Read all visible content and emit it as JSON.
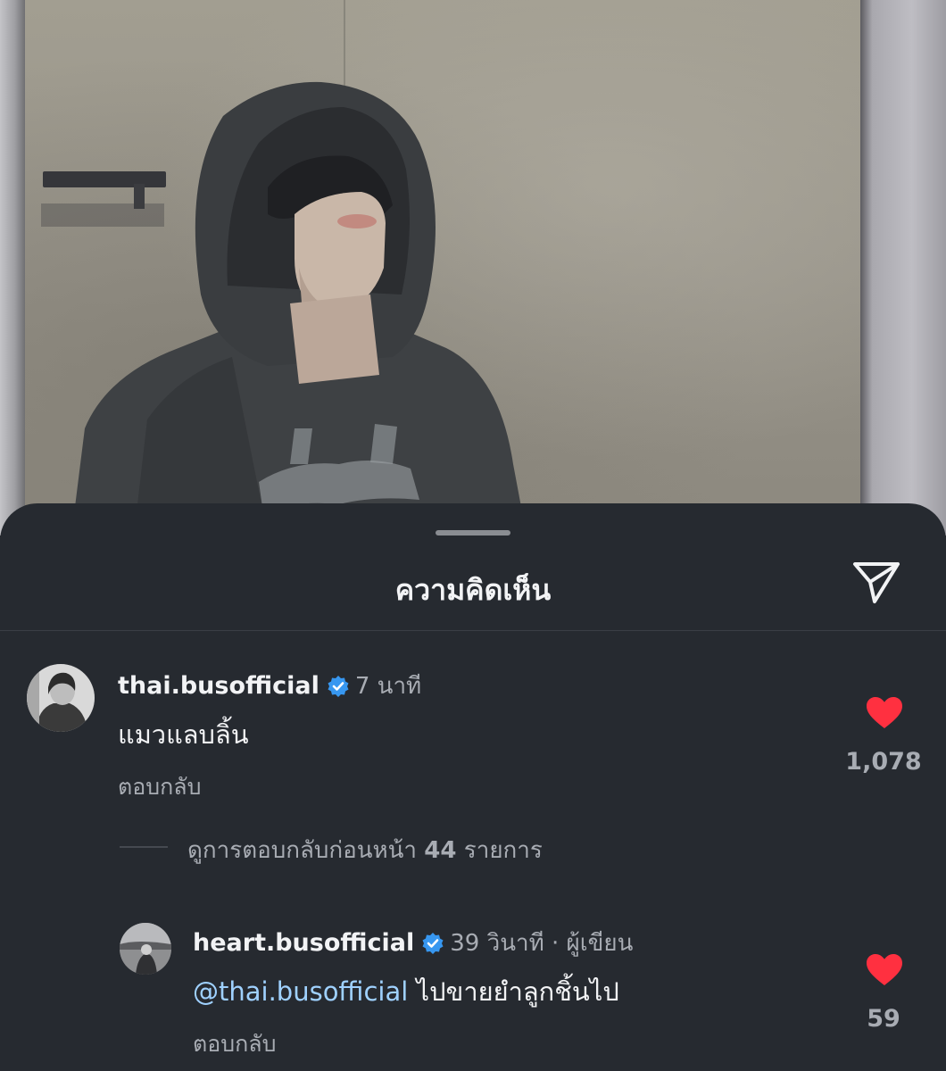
{
  "sheet": {
    "title": "ความคิดเห็น",
    "share_icon": "send-icon"
  },
  "comments": [
    {
      "username": "thai.busofficial",
      "verified": true,
      "time": "7 นาที",
      "text": "แมวแลบลิ้น",
      "reply_label": "ตอบกลับ",
      "likes": "1,078"
    }
  ],
  "view_replies": {
    "prefix": "ดูการตอบกลับก่อนหน้า",
    "count": "44",
    "suffix": "รายการ"
  },
  "replies": [
    {
      "username": "heart.busofficial",
      "verified": true,
      "time": "39 วินาที · ผู้เขียน",
      "mention": "@thai.busofficial",
      "text": "ไปขายยำลูกชิ้นไป",
      "reply_label": "ตอบกลับ",
      "likes": "59"
    }
  ],
  "colors": {
    "background": "#262a30",
    "heart": "#ff3040",
    "verified": "#3797f0",
    "mention": "#9fd1ff"
  }
}
